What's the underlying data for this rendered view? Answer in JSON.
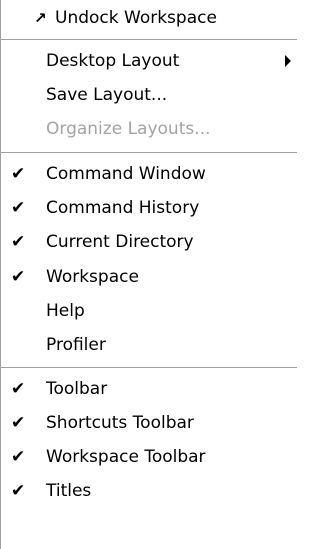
{
  "menu": {
    "header": {
      "icon": "undock-arrow-icon",
      "icon_glyph": "↗",
      "label": "Undock Workspace"
    },
    "group_layout": [
      {
        "label": "Desktop Layout",
        "has_submenu": true,
        "enabled": true
      },
      {
        "label": "Save Layout...",
        "has_submenu": false,
        "enabled": true
      },
      {
        "label": "Organize Layouts...",
        "has_submenu": false,
        "enabled": false
      }
    ],
    "group_windows": [
      {
        "label": "Command Window",
        "checked": true
      },
      {
        "label": "Command History",
        "checked": true
      },
      {
        "label": "Current Directory",
        "checked": true
      },
      {
        "label": "Workspace",
        "checked": true
      },
      {
        "label": "Help",
        "checked": false
      },
      {
        "label": "Profiler",
        "checked": false
      }
    ],
    "group_toolbars": [
      {
        "label": "Toolbar",
        "checked": true
      },
      {
        "label": "Shortcuts Toolbar",
        "checked": true
      },
      {
        "label": "Workspace Toolbar",
        "checked": true
      },
      {
        "label": "Titles",
        "checked": true
      }
    ],
    "check_glyph": "✔",
    "colors": {
      "text": "#000000",
      "disabled_text": "#a3a3a3",
      "separator": "#a0a0a0",
      "background": "#ffffff"
    }
  }
}
